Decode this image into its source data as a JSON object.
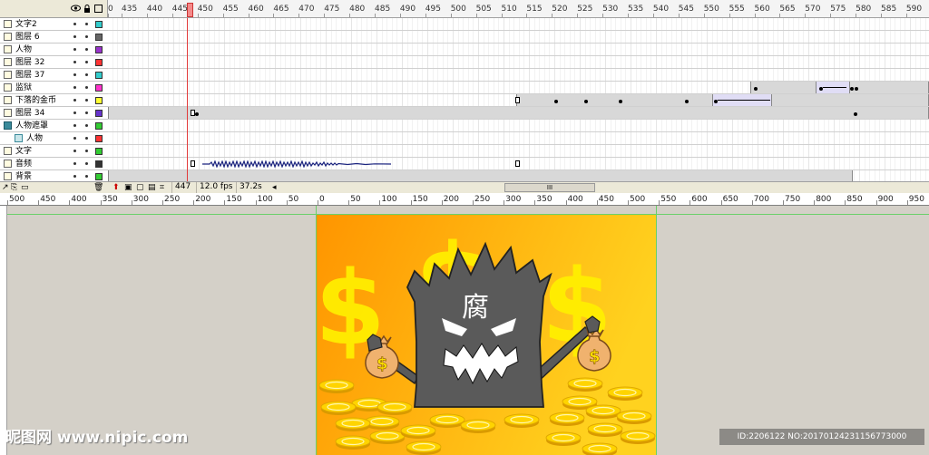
{
  "colors": {
    "stage_bg": "#d4d0c8",
    "guide": "#6ad06a",
    "playhead": "#e23b3b",
    "scene_orange": "#ff9500",
    "scene_yellow": "#ffd21f",
    "dollar_yellow": "#fff000",
    "monster_gray": "#5a5a5a",
    "coin_gold": "#ffd400"
  },
  "timeline": {
    "header_icons": [
      "eye-icon",
      "lock-icon",
      "outline-icon"
    ],
    "frame_ruler": [
      "0",
      "435",
      "440",
      "445",
      "450",
      "455",
      "460",
      "465",
      "470",
      "475",
      "480",
      "485",
      "490",
      "495",
      "500",
      "505",
      "510",
      "515",
      "520",
      "525",
      "530",
      "535",
      "540",
      "545",
      "550",
      "555",
      "560",
      "565",
      "570",
      "575",
      "580",
      "585",
      "590"
    ],
    "layers": [
      {
        "name": "文字2",
        "type": "normal",
        "color": "#33cccc"
      },
      {
        "name": "图层 6",
        "type": "normal",
        "color": "#666666"
      },
      {
        "name": "人物",
        "type": "normal",
        "color": "#9933cc"
      },
      {
        "name": "图层 32",
        "type": "normal",
        "color": "#ff3333"
      },
      {
        "name": "图层 37",
        "type": "normal",
        "color": "#33cccc"
      },
      {
        "name": "监狱",
        "type": "normal",
        "color": "#ff33cc"
      },
      {
        "name": "下落的金币",
        "type": "normal",
        "color": "#ffff33"
      },
      {
        "name": "图层 34",
        "type": "normal",
        "color": "#6633cc"
      },
      {
        "name": "人物遮罩",
        "type": "mask",
        "color": "#33cc33"
      },
      {
        "name": "人物",
        "type": "masked",
        "color": "#ff3333"
      },
      {
        "name": "文字",
        "type": "normal",
        "color": "#33cc33"
      },
      {
        "name": "音频",
        "type": "normal",
        "color": "#333333"
      },
      {
        "name": "背景",
        "type": "normal",
        "color": "#33cc33"
      }
    ],
    "footer": {
      "current_frame": "447",
      "fps": "12.0 fps",
      "elapsed": "37.2s",
      "scroll_label": "III"
    }
  },
  "stage": {
    "ruler_labels": [
      "500",
      "450",
      "400",
      "350",
      "300",
      "250",
      "200",
      "150",
      "100",
      "50",
      "0",
      "50",
      "100",
      "150",
      "200",
      "250",
      "300",
      "350",
      "400",
      "450",
      "500",
      "550",
      "600",
      "650",
      "700",
      "750",
      "800",
      "850",
      "900",
      "950"
    ],
    "character_text": "腐",
    "dollar_sign": "$"
  },
  "watermark": {
    "logo": "昵图网 www.nipic.com",
    "id_text": "ID:2206122 NO:20170124231156773000"
  }
}
